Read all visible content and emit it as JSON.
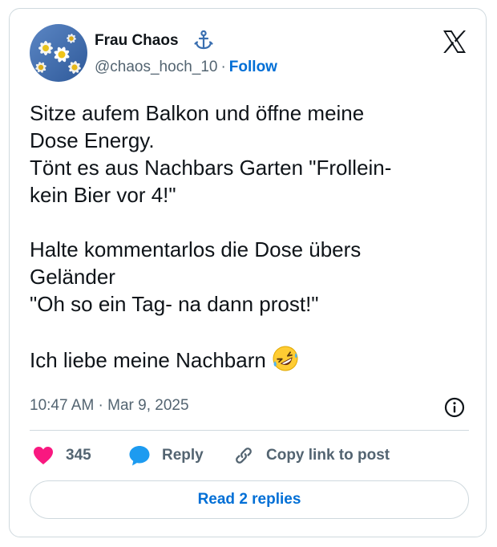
{
  "author": {
    "display_name": "Frau Chaos",
    "handle": "@chaos_hoch_10",
    "separator": "·",
    "follow_label": "Follow",
    "name_icon": "anchor-icon",
    "avatar": "daisies-avatar"
  },
  "platform_icon": "x-logo",
  "tweet": {
    "text": "Sitze aufem Balkon und öffne meine\nDose Energy.\nTönt es aus Nachbars Garten \"Frollein-\nkein Bier vor 4!\"\n\nHalte kommentarlos die Dose übers\nGeländer\n\"Oh so ein Tag- na dann prost!\"\n\nIch liebe meine Nachbarn ",
    "emoji": "rolling-on-the-floor-laughing-emoji"
  },
  "timestamp": "10:47 AM · Mar 9, 2025",
  "actions": {
    "like_count": "345",
    "reply_label": "Reply",
    "copy_link_label": "Copy link to post"
  },
  "read_replies_label": "Read 2 replies",
  "colors": {
    "like": "#f91880",
    "reply": "#1d9bf0",
    "link": "#006fd6",
    "secondary_text": "#536471",
    "border": "#cfd9de"
  }
}
